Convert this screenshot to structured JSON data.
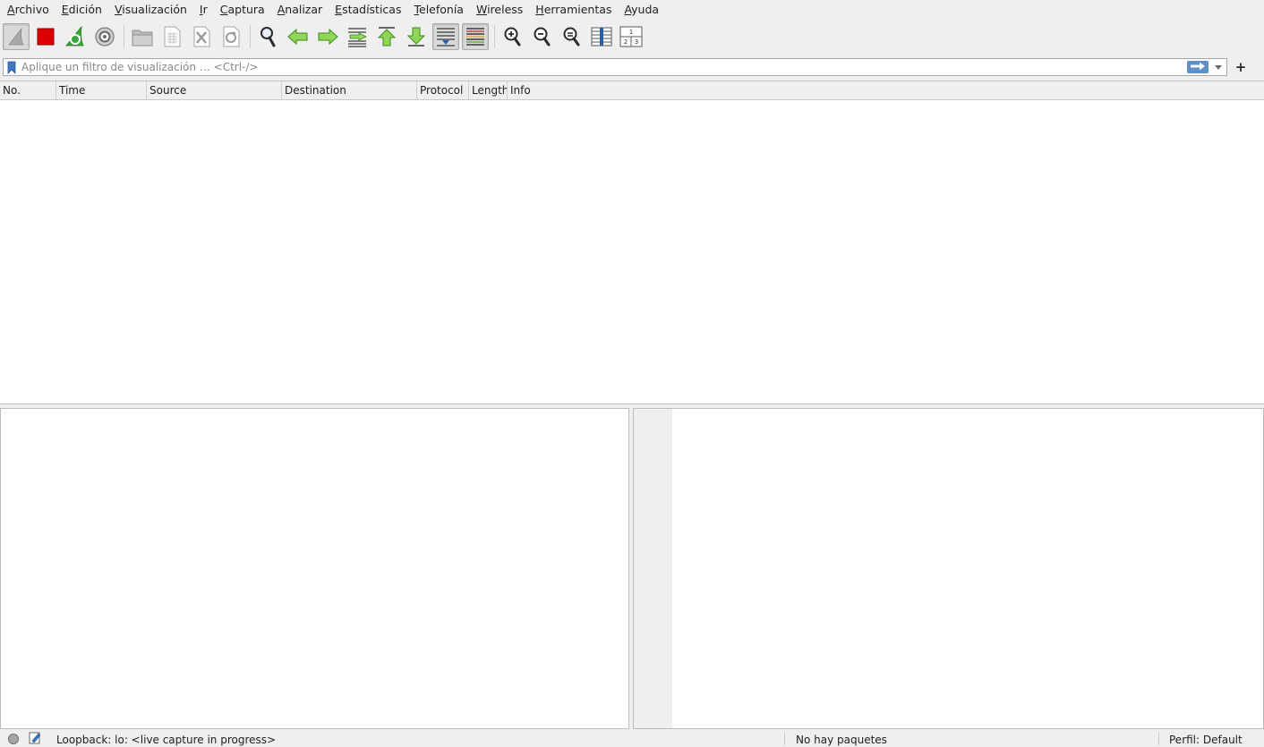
{
  "menubar": {
    "items": [
      {
        "mn": "A",
        "rest": "rchivo"
      },
      {
        "mn": "E",
        "rest": "dición"
      },
      {
        "mn": "V",
        "rest": "isualización"
      },
      {
        "mn": "I",
        "rest": "r"
      },
      {
        "mn": "C",
        "rest": "aptura"
      },
      {
        "mn": "A",
        "rest": "nalizar"
      },
      {
        "mn": "E",
        "rest": "stadísticas"
      },
      {
        "mn": "T",
        "rest": "elefonía"
      },
      {
        "mn": "W",
        "rest": "ireless"
      },
      {
        "mn": "H",
        "rest": "erramientas"
      },
      {
        "mn": "A",
        "rest": "yuda"
      }
    ]
  },
  "toolbar": {
    "icons": [
      "shark-fin-start-capture-icon",
      "stop-capture-icon",
      "restart-capture-icon",
      "capture-options-icon",
      "open-file-icon",
      "save-file-icon",
      "close-file-icon",
      "reload-file-icon",
      "find-packet-icon",
      "go-back-icon",
      "go-forward-icon",
      "go-to-packet-icon",
      "first-packet-icon",
      "last-packet-icon",
      "auto-scroll-icon",
      "colorize-icon",
      "zoom-in-icon",
      "zoom-out-icon",
      "zoom-normal-icon",
      "resize-columns-icon",
      "layout-panes-icon"
    ],
    "accent_red": "#dd0000",
    "accent_green": "#3aa93a"
  },
  "filter": {
    "placeholder": "Aplique un filtro de visualización … <Ctrl-/>",
    "value": "",
    "add_label": "+",
    "apply_color": "#5e8fc7"
  },
  "packet_list": {
    "columns": [
      "No.",
      "Time",
      "Source",
      "Destination",
      "Protocol",
      "Length",
      "Info"
    ],
    "rows": []
  },
  "statusbar": {
    "interface_text": "Loopback: lo: <live capture in progress>",
    "packets_text": "No hay paquetes",
    "profile_text": "Perfil: Default"
  }
}
